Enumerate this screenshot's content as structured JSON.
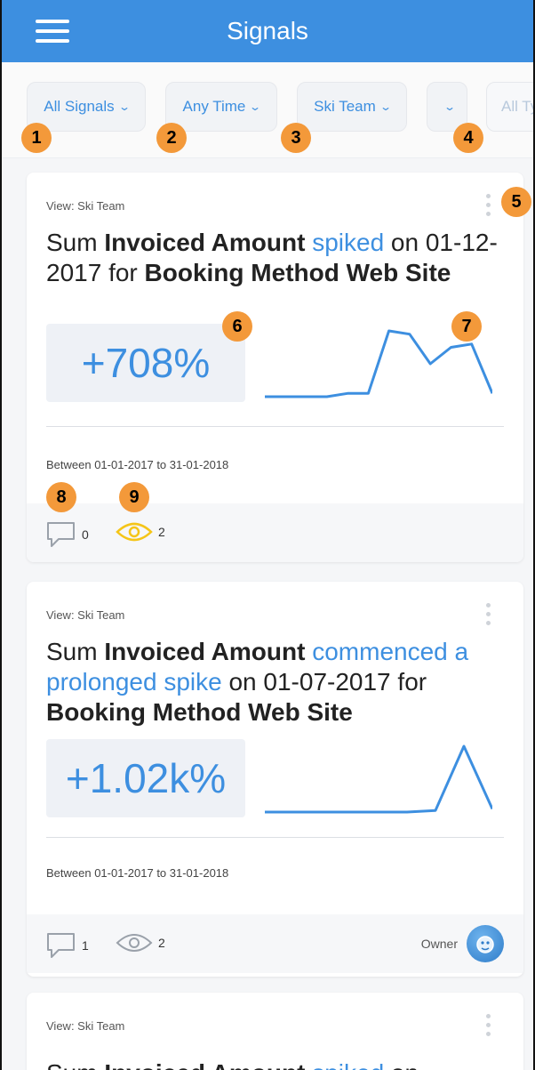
{
  "header": {
    "title": "Signals",
    "menu_icon": "hamburger-menu-icon"
  },
  "filters": [
    {
      "label": "All Signals"
    },
    {
      "label": "Any Time"
    },
    {
      "label": "Ski Team"
    },
    {
      "label": ""
    },
    {
      "label": "All Ty"
    }
  ],
  "badges": [
    "1",
    "2",
    "3",
    "4",
    "5",
    "6",
    "7",
    "8",
    "9"
  ],
  "colors": {
    "accent": "#3d8fe0",
    "badge": "#f3993a",
    "eye_highlight": "#f5c518"
  },
  "cards": [
    {
      "view": "View: Ski Team",
      "title_pre": "Sum ",
      "title_metric": "Invoiced Amount",
      "title_event": "spiked",
      "title_mid": " on 01-12-2017 for ",
      "title_segment": "Booking Method Web Site",
      "change": "+708%",
      "range": "Between 01-01-2017 to 31-01-2018",
      "comments": "0",
      "views": "2",
      "sparkline": [
        2,
        2,
        2,
        2,
        3,
        3,
        22,
        21,
        12,
        17,
        18,
        3
      ]
    },
    {
      "view": "View: Ski Team",
      "title_pre": "Sum ",
      "title_metric": "Invoiced Amount",
      "title_event": "commenced a prolonged spike",
      "title_mid": " on 01-07-2017 for ",
      "title_segment": "Booking Method Web Site",
      "change": "+1.02k%",
      "range": "Between 01-01-2017 to 31-01-2018",
      "comments": "1",
      "views": "2",
      "owner_label": "Owner",
      "sparkline": [
        1,
        1,
        1,
        1,
        1,
        1,
        1.5,
        22,
        2
      ]
    },
    {
      "view": "View: Ski Team",
      "title_pre": "Sum ",
      "title_metric": "Invoiced Amount",
      "title_event": "spiked",
      "title_mid": " on"
    }
  ]
}
